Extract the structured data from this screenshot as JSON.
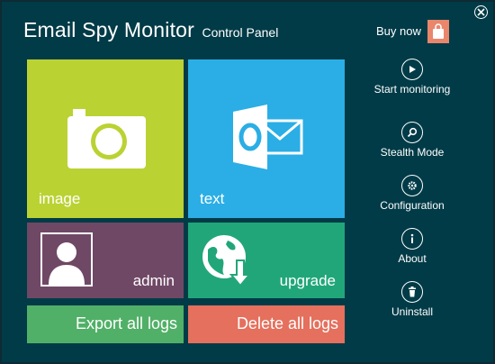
{
  "window": {
    "app_title": "Email Spy Monitor",
    "subtitle": "Control Panel",
    "buy_label": "Buy now"
  },
  "tiles": {
    "image": "image",
    "text": "text",
    "admin": "admin",
    "upgrade": "upgrade",
    "export": "Export all logs",
    "delete": "Delete all logs"
  },
  "sidebar": {
    "items": [
      {
        "label": "Start monitoring",
        "icon": "play-icon"
      },
      {
        "label": "Stealth Mode",
        "icon": "search-icon"
      },
      {
        "label": "Configuration",
        "icon": "gear-icon"
      },
      {
        "label": "About",
        "icon": "info-icon"
      },
      {
        "label": "Uninstall",
        "icon": "trash-icon"
      }
    ]
  },
  "colors": {
    "background": "#003b47",
    "image_tile": "#bbd233",
    "text_tile": "#2aaee5",
    "admin_tile": "#6f4865",
    "upgrade_tile": "#21a67a",
    "export_tile": "#51b067",
    "delete_tile": "#e4705d",
    "buy_badge": "#e9866c"
  }
}
